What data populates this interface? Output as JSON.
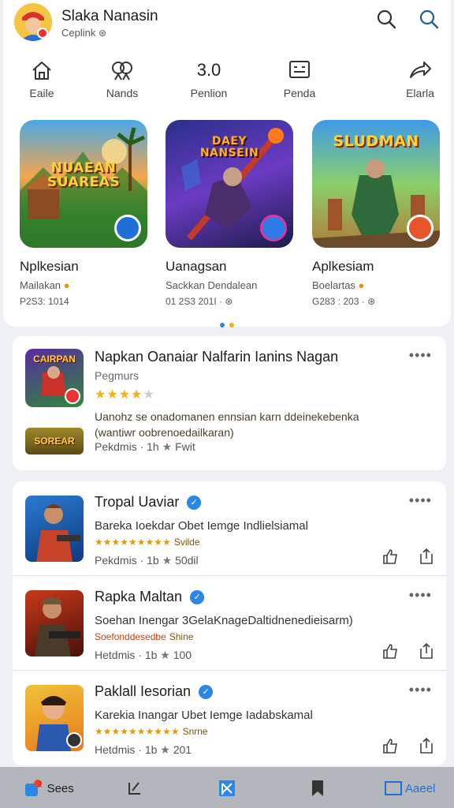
{
  "header": {
    "title": "Slaka Nanasin",
    "subtitle": "Ceplink",
    "icons": [
      "search-icon",
      "search-icon"
    ]
  },
  "nav": [
    {
      "label": "Eaile",
      "icon": "home-icon"
    },
    {
      "label": "Nands",
      "icon": "people-icon"
    },
    {
      "label": "Penlion",
      "value": "3.0"
    },
    {
      "label": "Penda",
      "icon": "inbox-icon"
    },
    {
      "label": "Elarla",
      "icon": "share-icon"
    }
  ],
  "featured": [
    {
      "art_text": "NUAEAN SUAREAS",
      "name": "Nplkesian",
      "sub": "Mailakan",
      "meta": "P2S3: 1014",
      "accent": "#2d8c3a"
    },
    {
      "art_text": "DAEY NANSEIN",
      "name": "Uanagsan",
      "sub": "Sackkan Dendalean",
      "meta": "01 2S3 201I",
      "accent": "#3b56c6"
    },
    {
      "art_text": "SLUDMAN",
      "name": "Aplkesiam",
      "sub": "Boelartas",
      "meta": "G283 : 203",
      "accent": "#e2a21c"
    }
  ],
  "promo": {
    "title": "Napkan Oanaiar Nalfarin Ianins Nagan",
    "sub": "Pegmurs",
    "rating": "★★★★",
    "rating_empty": "★",
    "desc1": "Uanohz se onadomanen ennsian karn ddeinekebenka",
    "desc2": "(wantiwr oobrenoedailkaran)",
    "thumb_text": "CAIRPAN",
    "thumb2_text": "SOREAR",
    "foot_a": "Pekdmis",
    "foot_b": "1h",
    "foot_c": "Fwit"
  },
  "list": [
    {
      "title": "Tropal Uaviar",
      "line1": "Bareka Ioekdar  Obet Iemge Indlielsiamal",
      "stars": "★★★★★★★★★",
      "stars_text": "Svilde",
      "foot_a": "Pekdmis",
      "foot_b": "1b",
      "foot_c": "50dil"
    },
    {
      "title": "Rapka Maltan",
      "line1": "Soehan Inengar 3GelaKnageDaltidnenedieisarm)",
      "stars": "Soefonddesedbe",
      "stars_text": "Shine",
      "foot_a": "Hetdmis",
      "foot_b": "1b",
      "foot_c": "100"
    },
    {
      "title": "Paklall Iesorian",
      "line1": "Karekia Inangar  Ubet Iemge Iadabskamal",
      "stars": "★★★★★★★★★★",
      "stars_text": "Snrne",
      "foot_a": "Hetdmis",
      "foot_b": "1b",
      "foot_c": "201"
    }
  ],
  "bottom": {
    "tab1": "Sees",
    "tab1_badge": "2",
    "tab5": "Aaeel"
  },
  "colors": {
    "accent": "#2a86e8",
    "star": "#f2b01e"
  }
}
